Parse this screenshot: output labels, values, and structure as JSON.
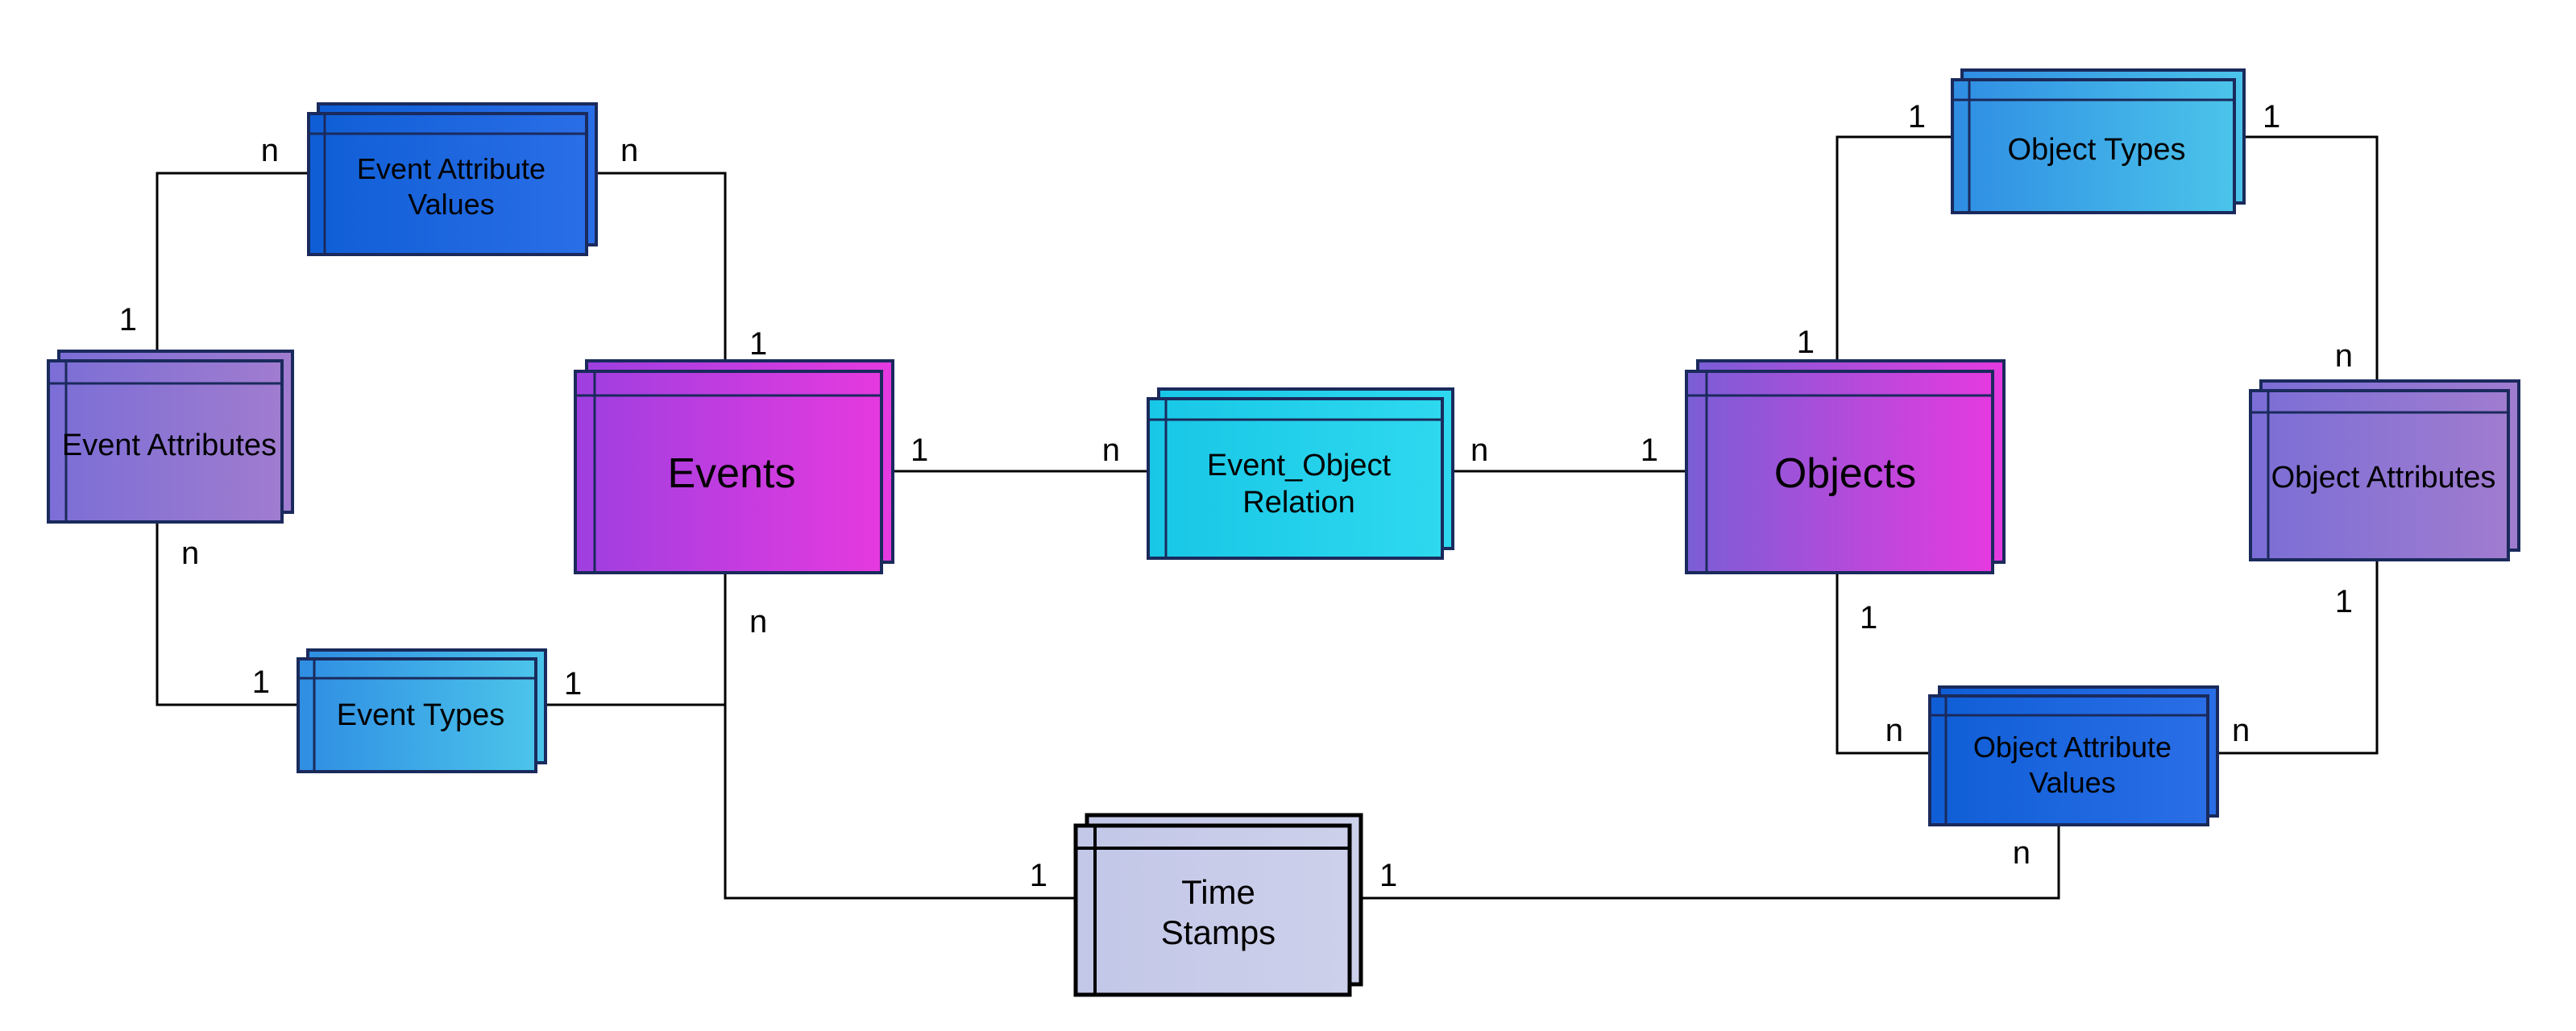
{
  "entities": {
    "event_attributes": {
      "label": "Event Attributes",
      "multiline": false
    },
    "event_attribute_values": {
      "label1": "Event Attribute",
      "label2": "Values"
    },
    "events": {
      "label": "Events",
      "multiline": false
    },
    "event_types": {
      "label": "Event Types",
      "multiline": false
    },
    "event_object_relation": {
      "label1": "Event_Object",
      "label2": "Relation"
    },
    "time_stamps": {
      "label1": "Time",
      "label2": "Stamps"
    },
    "objects": {
      "label": "Objects",
      "multiline": false
    },
    "object_types": {
      "label": "Object Types",
      "multiline": false
    },
    "object_attributes": {
      "label": "Object Attributes",
      "multiline": false
    },
    "object_attribute_values": {
      "label1": "Object Attribute",
      "label2": "Values"
    }
  },
  "cardinalities": {
    "ea_eav_ea_side": "1",
    "ea_eav_eav_side": "n",
    "eav_ev_eav_side": "n",
    "eav_ev_ev_side": "1",
    "ea_et_ea_side": "n",
    "ea_et_et_side": "1",
    "et_ev_et_side": "1",
    "et_ev_ev_side": "n",
    "ev_eor_ev_side": "1",
    "ev_eor_eor_left": "n",
    "eor_obj_eor_right": "n",
    "eor_obj_obj_side": "1",
    "ev_ts_ev_side": "n",
    "ev_ts_ts_left": "1",
    "ts_oav_ts_right": "1",
    "ts_oav_oav_side": "n",
    "obj_ot_obj_side": "1",
    "obj_ot_ot_side": "1",
    "ot_oa_ot_side": "1",
    "ot_oa_oa_side": "n",
    "obj_oav_obj_side": "1",
    "obj_oav_oav_side": "n",
    "oav_oa_oav_side": "n",
    "oav_oa_oa_side": "1"
  },
  "colors": {
    "stroke": "#1a2a5c",
    "event_attributes_g1": "#7b6ed6",
    "event_attributes_g2": "#a07ccf",
    "event_attribute_values_g1": "#0f5ed6",
    "event_attribute_values_g2": "#2a6ee6",
    "events_g1": "#9e3fe0",
    "events_g2": "#e53adf",
    "event_types_g1": "#2f8de3",
    "event_types_g2": "#4bc4ea",
    "event_object_relation_g1": "#18c7e6",
    "event_object_relation_g2": "#2ed8ef",
    "time_stamps_g1": "#c3c7e8",
    "time_stamps_g2": "#cdd0ea",
    "objects_g1": "#7a5ed6",
    "objects_g2": "#e53adf",
    "object_types_g1": "#2f8de3",
    "object_types_g2": "#4bc4ea",
    "object_attributes_g1": "#7b6ed6",
    "object_attributes_g2": "#a07ccf",
    "object_attribute_values_g1": "#0f5ed6",
    "object_attribute_values_g2": "#2a6ee6"
  }
}
